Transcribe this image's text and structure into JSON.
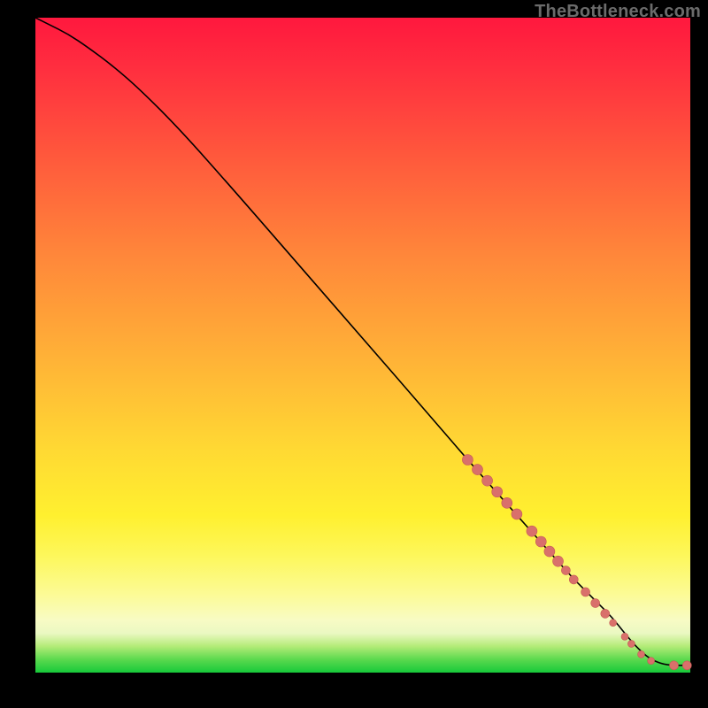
{
  "watermark": "TheBottleneck.com",
  "colors": {
    "marker_fill": "#d9706b",
    "marker_stroke": "#c55a55",
    "line": "#000000",
    "gradient_top": "#ff183e",
    "gradient_bottom": "#17c93a",
    "page_bg": "#000000"
  },
  "chart_data": {
    "type": "line",
    "title": "",
    "xlabel": "",
    "ylabel": "",
    "xlim": [
      0,
      100
    ],
    "ylim": [
      0,
      100
    ],
    "grid": false,
    "legend": false,
    "series": [
      {
        "name": "curve",
        "kind": "line",
        "x": [
          0,
          2,
          5,
          8,
          12,
          16,
          22,
          30,
          40,
          50,
          60,
          66,
          70,
          74,
          78,
          82,
          84,
          86,
          88,
          90,
          91,
          92.5,
          94,
          96,
          98,
          100
        ],
        "y": [
          100,
          99,
          97.5,
          95.5,
          92.5,
          89,
          83,
          74,
          62.5,
          51,
          39.5,
          32.5,
          28,
          23.5,
          19,
          14.5,
          12.5,
          10.5,
          8.5,
          6,
          4.8,
          3.2,
          2.0,
          1.2,
          1.1,
          1.1
        ]
      },
      {
        "name": "points",
        "kind": "scatter",
        "points": [
          {
            "x": 66.0,
            "y": 32.5,
            "r": 6
          },
          {
            "x": 67.5,
            "y": 31.0,
            "r": 6
          },
          {
            "x": 69.0,
            "y": 29.3,
            "r": 6
          },
          {
            "x": 70.5,
            "y": 27.6,
            "r": 6
          },
          {
            "x": 72.0,
            "y": 25.9,
            "r": 6
          },
          {
            "x": 73.5,
            "y": 24.2,
            "r": 6
          },
          {
            "x": 75.8,
            "y": 21.6,
            "r": 6
          },
          {
            "x": 77.2,
            "y": 20.0,
            "r": 6
          },
          {
            "x": 78.5,
            "y": 18.5,
            "r": 6
          },
          {
            "x": 79.8,
            "y": 17.0,
            "r": 6
          },
          {
            "x": 81.0,
            "y": 15.6,
            "r": 5
          },
          {
            "x": 82.2,
            "y": 14.2,
            "r": 5
          },
          {
            "x": 84.0,
            "y": 12.3,
            "r": 5
          },
          {
            "x": 85.5,
            "y": 10.6,
            "r": 5
          },
          {
            "x": 87.0,
            "y": 9.0,
            "r": 5
          },
          {
            "x": 88.2,
            "y": 7.6,
            "r": 4
          },
          {
            "x": 90.0,
            "y": 5.5,
            "r": 4
          },
          {
            "x": 91.0,
            "y": 4.4,
            "r": 4
          },
          {
            "x": 92.5,
            "y": 2.8,
            "r": 4
          },
          {
            "x": 94.0,
            "y": 1.8,
            "r": 4
          },
          {
            "x": 97.5,
            "y": 1.1,
            "r": 5
          },
          {
            "x": 99.5,
            "y": 1.1,
            "r": 5
          }
        ]
      }
    ]
  }
}
